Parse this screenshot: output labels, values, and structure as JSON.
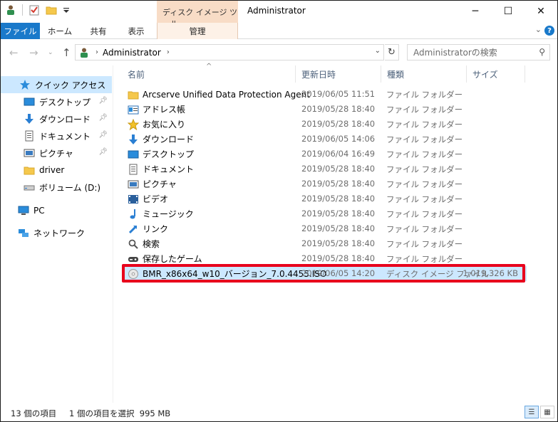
{
  "window": {
    "title": "Administrator",
    "context_tab_header": "ディスク イメージ ツール",
    "controls": {
      "minimize": "─",
      "maximize": "☐",
      "close": "✕"
    }
  },
  "ribbon": {
    "tabs": {
      "file": "ファイル",
      "home": "ホーム",
      "share": "共有",
      "view": "表示",
      "manage": "管理"
    },
    "help": "?"
  },
  "address": {
    "crumb": "Administrator",
    "search_placeholder": "Administratorの検索"
  },
  "nav": {
    "quick_access": "クイック アクセス",
    "items": [
      {
        "label": "デスクトップ",
        "icon": "desktop-icon",
        "pinned": true
      },
      {
        "label": "ダウンロード",
        "icon": "download-icon",
        "pinned": true
      },
      {
        "label": "ドキュメント",
        "icon": "document-icon",
        "pinned": true
      },
      {
        "label": "ピクチャ",
        "icon": "picture-icon",
        "pinned": true
      },
      {
        "label": "driver",
        "icon": "folder-icon",
        "pinned": false
      },
      {
        "label": "ボリューム (D:)",
        "icon": "drive-icon",
        "pinned": false
      }
    ],
    "pc": "PC",
    "network": "ネットワーク"
  },
  "columns": {
    "name": "名前",
    "date": "更新日時",
    "type": "種類",
    "size": "サイズ"
  },
  "files": [
    {
      "name": "Arcserve Unified Data Protection Agent",
      "date": "2019/06/05 11:51",
      "type": "ファイル フォルダー",
      "size": "",
      "icon": "folder-icon"
    },
    {
      "name": "アドレス帳",
      "date": "2019/05/28 18:40",
      "type": "ファイル フォルダー",
      "size": "",
      "icon": "contacts-icon"
    },
    {
      "name": "お気に入り",
      "date": "2019/05/28 18:40",
      "type": "ファイル フォルダー",
      "size": "",
      "icon": "star-icon"
    },
    {
      "name": "ダウンロード",
      "date": "2019/06/05 14:06",
      "type": "ファイル フォルダー",
      "size": "",
      "icon": "download-icon"
    },
    {
      "name": "デスクトップ",
      "date": "2019/06/04 16:49",
      "type": "ファイル フォルダー",
      "size": "",
      "icon": "desktop-icon"
    },
    {
      "name": "ドキュメント",
      "date": "2019/05/28 18:40",
      "type": "ファイル フォルダー",
      "size": "",
      "icon": "document-icon"
    },
    {
      "name": "ピクチャ",
      "date": "2019/05/28 18:40",
      "type": "ファイル フォルダー",
      "size": "",
      "icon": "picture-icon"
    },
    {
      "name": "ビデオ",
      "date": "2019/05/28 18:40",
      "type": "ファイル フォルダー",
      "size": "",
      "icon": "video-icon"
    },
    {
      "name": "ミュージック",
      "date": "2019/05/28 18:40",
      "type": "ファイル フォルダー",
      "size": "",
      "icon": "music-icon"
    },
    {
      "name": "リンク",
      "date": "2019/05/28 18:40",
      "type": "ファイル フォルダー",
      "size": "",
      "icon": "link-icon"
    },
    {
      "name": "検索",
      "date": "2019/05/28 18:40",
      "type": "ファイル フォルダー",
      "size": "",
      "icon": "search-icon"
    },
    {
      "name": "保存したゲーム",
      "date": "2019/05/28 18:40",
      "type": "ファイル フォルダー",
      "size": "",
      "icon": "game-icon"
    },
    {
      "name": "BMR_x86x64_w10_バージョン_7.0.4455.ISO",
      "date": "2019/06/05 14:20",
      "type": "ディスク イメージ ファイル",
      "size": "1,019,326 KB",
      "icon": "disc-image-icon",
      "selected": true
    }
  ],
  "status": {
    "count": "13 個の項目",
    "selection": "1 個の項目を選択  995 MB"
  },
  "colors": {
    "file_tab": "#1979ca",
    "context_tab": "#f8dcc6",
    "selection": "#cce8ff",
    "highlight": "#e8001c"
  }
}
